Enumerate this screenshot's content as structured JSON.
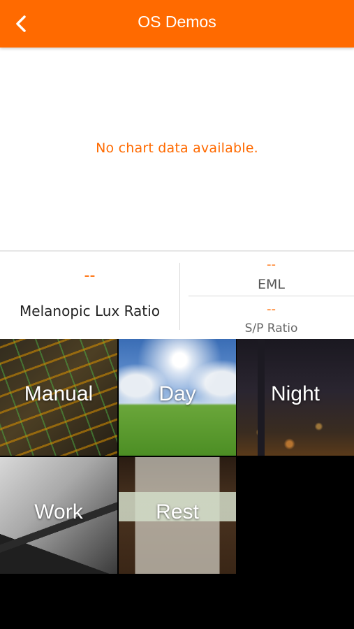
{
  "header": {
    "title": "OS Demos",
    "back_icon": "chevron-left-icon",
    "background_color": "#ff6a00"
  },
  "chart": {
    "empty_message": "No chart data available."
  },
  "metrics": {
    "melanopic_lux_ratio": {
      "value": "--",
      "label": "Melanopic Lux Ratio"
    },
    "eml": {
      "value": "--",
      "label": "EML"
    },
    "sp_ratio": {
      "value": "--",
      "label": "S/P Ratio"
    }
  },
  "tiles": [
    {
      "label": "Manual"
    },
    {
      "label": "Day"
    },
    {
      "label": "Night"
    },
    {
      "label": "Work"
    },
    {
      "label": "Rest"
    }
  ],
  "colors": {
    "accent": "#ff6a00"
  }
}
